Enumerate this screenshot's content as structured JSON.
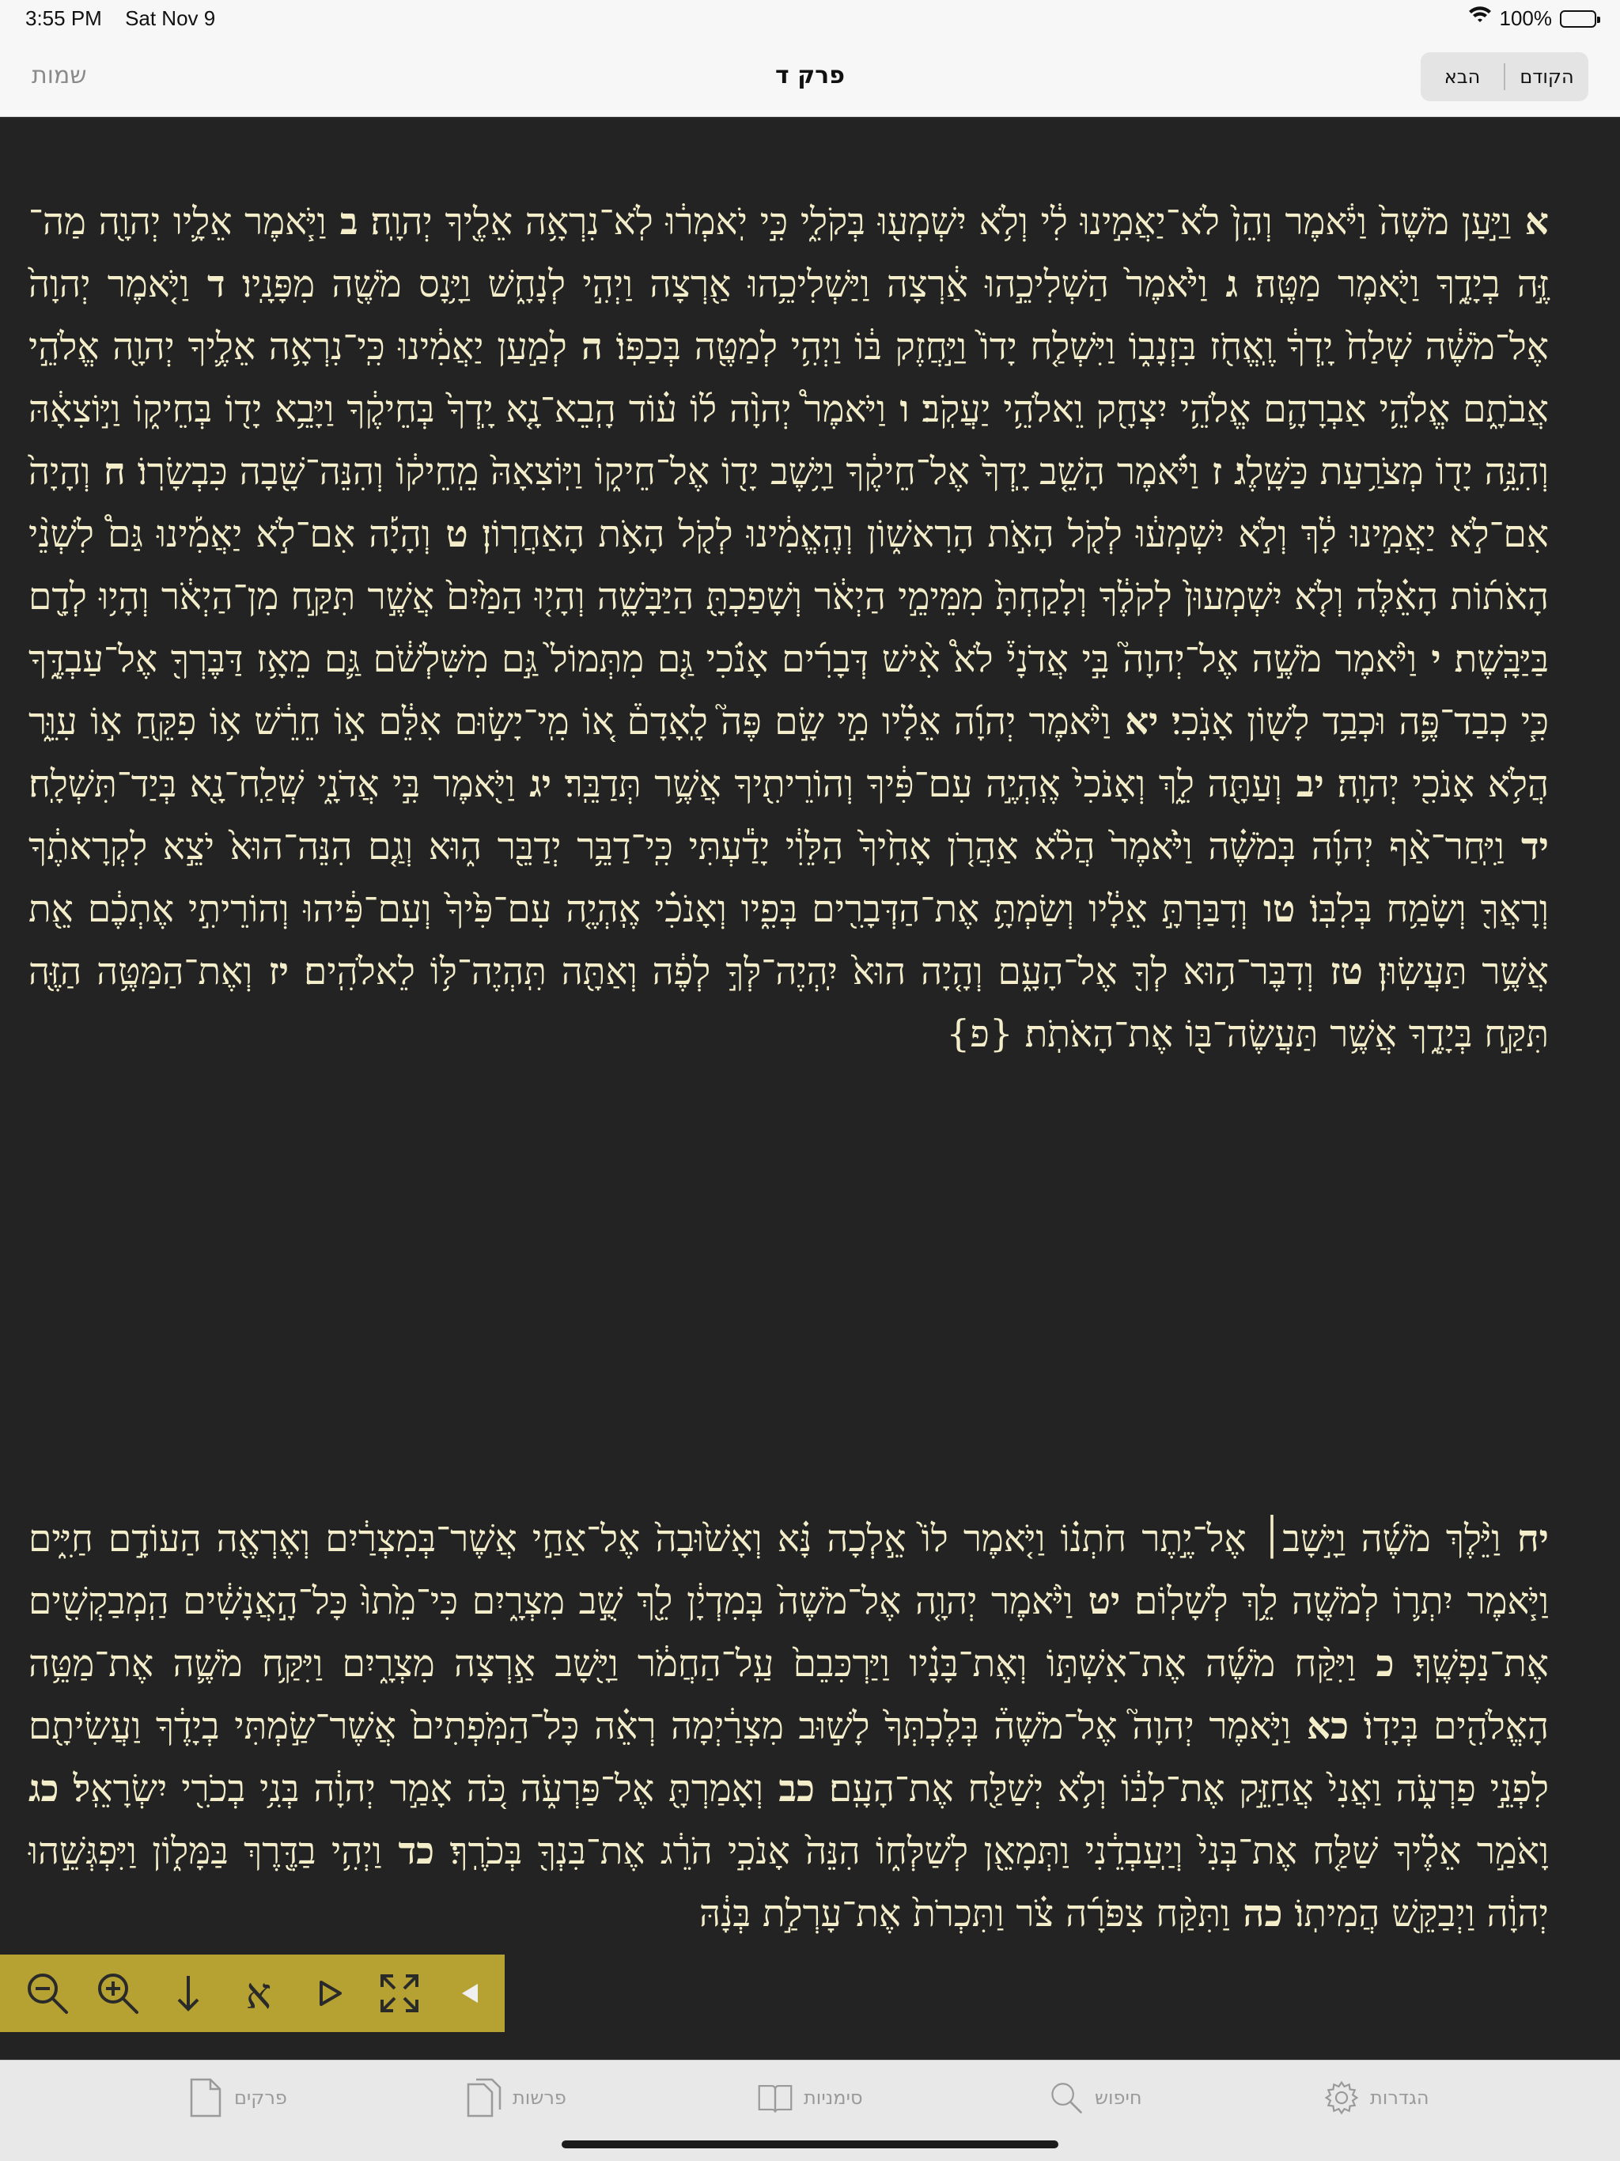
{
  "status": {
    "time": "3:55 PM",
    "date": "Sat Nov 9",
    "battery": "100%",
    "battery_level": 1.0
  },
  "nav": {
    "title": "פרק ד",
    "back_label": "שמות",
    "prev_label": "הקודם",
    "next_label": "הבא"
  },
  "text": {
    "para1": [
      {
        "n": "א",
        "t": "וַיַּ֣עַן מֹשֶׁה֙ וַיֹּ֔אמֶר וְהֵן֙ לֹא־יַאֲמִ֣ינוּ לִ֔י וְלֹ֥א יִשְׁמְע֖וּ בְּקֹלִ֑י כִּ֣י יֹֽאמְר֔וּ לֹֽא־נִרְאָ֥ה אֵלֶ֖יךָ יְהוָֽה׃"
      },
      {
        "n": "ב",
        "t": "וַיֹּ֧אמֶר אֵלָ֛יו יְהוָ֖ה מַה־ זֶּ֣ה בְיָדֶ֑ךָ וַיֹּ֖אמֶר מַטֶּֽה׃"
      },
      {
        "n": "ג",
        "t": "וַיֹּ֙אמֶר֙ הַשְׁלִיכֵ֣הוּ אַ֔רְצָה וַיַּשְׁלִיכֵ֥הוּ אַ֖רְצָה וַיְהִ֣י לְנָחָ֑שׁ וַיָּ֥נָס מֹשֶׁ֖ה מִפָּנָֽיו׃"
      },
      {
        "n": "ד",
        "t": "וַיֹּ֤אמֶר יְהוָה֙ אֶל־מֹשֶׁ֔ה שְׁלַח֙ יָֽדְךָ֔ וֶֽאֱחֹ֖ז בִּזְנָב֑וֹ וַיִּשְׁלַ֤ח יָדוֹ֙ וַיַּ֣חֲזֶק בּ֔וֹ וַיְהִ֥י לְמַטֶּ֖ה בְּכַפּֽוֹ׃"
      },
      {
        "n": "ה",
        "t": "לְמַ֣עַן יַאֲמִ֔ינוּ כִּֽי־נִרְאָ֥ה אֵלֶ֛יךָ יְהוָ֖ה אֱלֹהֵ֣י אֲבֹתָ֑ם אֱלֹהֵ֥י אַבְרָהָ֛ם אֱלֹהֵ֥י יִצְחָ֖ק וֵאלֹהֵ֥י יַעֲקֹֽב׃"
      },
      {
        "n": "ו",
        "t": "וַיֹּאמֶר֩ יְהוָ֨ה ל֜וֹ ע֗וֹד הָֽבֵא־נָ֤א יָֽדְךָ֙ בְּחֵיקֶ֔ךָ וַיָּבֵ֥א יָד֖וֹ בְּחֵיק֑וֹ וַיּ֣וֹצִאָ֔הּ וְהִנֵּ֥ה יָד֖וֹ מְצֹרַ֥עַת כַּשָּֽׁלֶג׃"
      },
      {
        "n": "ז",
        "t": "וַיֹּ֗אמֶר הָשֵׁ֤ב יָֽדְךָ֙ אֶל־חֵיקֶ֔ךָ וַיָּ֥שֶׁב יָד֖וֹ אֶל־חֵיק֑וֹ וַיּֽוֹצִאָהּ֙ מֵֽחֵיק֔וֹ וְהִנֵּה־שָׁ֖בָה כִּבְשָׂרֽוֹ׃"
      },
      {
        "n": "ח",
        "t": "וְהָיָה֙ אִם־לֹ֣א יַאֲמִ֣ינוּ לָ֔ךְ וְלֹ֣א יִשְׁמְע֔וּ לְקֹ֖ל הָאֹ֣ת הָרִאשׁ֑וֹן וְהֶֽאֱמִ֔ינוּ לְקֹ֖ל הָאֹ֥ת הָאַחֲרֽוֹן׃"
      },
      {
        "n": "ט",
        "t": "וְהָיָ֡ה אִם־לֹ֣א יַאֲמִ֡ינוּ גַּם֩ לִשְׁנֵ֨י הָאֹת֜וֹת הָאֵ֗לֶּה וְלֹ֤א יִשְׁמְעוּן֙ לְקֹלֶ֔ךָ וְלָקַחְתָּ֙ מִמֵּימֵ֣י הַיְאֹ֔ר וְשָׁפַכְתָּ֖ הַיַּבָּשָׁ֑ה וְהָי֤וּ הַמַּ֙יִם֙ אֲשֶׁ֣ר תִּקַּ֣ח מִן־הַיְאֹ֔ר וְהָי֥וּ לְדָ֖ם בַּיַּבָּֽשֶׁת׃"
      },
      {
        "n": "י",
        "t": "וַיֹּ֨אמֶר מֹשֶׁ֣ה אֶל־יְהוָה֮ בִּ֣י אֲדֹנָי֒ לֹא֩ אִ֨ישׁ דְּבָרִ֜ים אָנֹ֗כִי גַּ֤ם מִתְּמוֹל֙ גַּ֣ם מִשִּׁלְשֹׁ֔ם גַּ֛ם מֵאָ֥ז דַּבֶּרְךָ֖ אֶל־עַבְדֶּ֑ךָ כִּ֧י כְבַד־פֶּ֛ה וּכְבַ֥ד לָשׁ֖וֹן אָנֹֽכִי׃"
      },
      {
        "n": "יא",
        "t": "וַיֹּ֨אמֶר יְהוָ֜ה אֵלָ֗יו מִ֣י שָׂ֣ם פֶּה֮ לָֽאָדָם֒ א֚וֹ מִֽי־יָשׂ֣וּם אִלֵּ֔ם א֣וֹ חֵרֵ֔שׁ א֥וֹ פִקֵּ֖חַ א֣וֹ עִוֵּ֑ר הֲלֹ֥א אָנֹכִ֖י יְהוָֽה׃"
      },
      {
        "n": "יב",
        "t": "וְעַתָּ֖ה לֵ֑ךְ וְאָנֹכִי֙ אֶֽהְיֶ֣ה עִם־פִּ֔יךָ וְהוֹרֵיתִ֖יךָ אֲשֶׁ֥ר תְּדַבֵּֽר׃"
      },
      {
        "n": "יג",
        "t": "וַיֹּ֖אמֶר בִּ֣י אֲדֹנָ֑י שְֽׁלַֽח־נָ֖א בְּיַד־תִּשְׁלָֽח׃"
      },
      {
        "n": "יד",
        "t": "וַיִּֽחַר־אַ֨ף יְהוָ֜ה בְּמֹשֶׁ֗ה וַיֹּ֙אמֶר֙ הֲלֹ֨א אַהֲרֹ֤ן אָחִ֙יךָ֙ הַלֵּוִ֔י יָדַ֕עְתִּי כִּֽי־דַבֵּ֥ר יְדַבֵּ֖ר ה֑וּא וְגַ֤ם הִנֵּה־הוּא֙ יֹצֵ֣א לִקְרָאתֶ֔ךָ וְרָאֲךָ֖ וְשָׂמַ֥ח בְּלִבּֽוֹ׃"
      },
      {
        "n": "טו",
        "t": "וְדִבַּרְתָּ֣ אֵלָ֔יו וְשַׂמְתָּ֥ אֶת־הַדְּבָרִ֖ים בְּפִ֑יו וְאָנֹכִ֗י אֶֽהְיֶ֤ה עִם־פִּ֙יךָ֙ וְעִם־פִּ֔יהוּ וְהוֹרֵיתִ֣י אֶתְכֶ֔ם אֵ֖ת אֲשֶׁ֥ר תַּעֲשֽׂוּן׃"
      },
      {
        "n": "טז",
        "t": "וְדִבֶּר־ה֥וּא לְךָ֖ אֶל־הָעָ֑ם וְהָ֤יָה הוּא֙ יִֽהְיֶה־לְּךָ֣ לְפֶ֔ה וְאַתָּ֖ה תִּֽהְיֶה־לּ֥וֹ לֵאלֹהִֽים׃"
      },
      {
        "n": "יז",
        "t": "וְאֶת־הַמַּטֶּ֥ה הַזֶּ֖ה תִּקַּ֣ח בְּיָדֶ֑ךָ אֲשֶׁ֥ר תַּעֲשֶׂה־בּ֖וֹ אֶת־הָאֹתֹֽת׃ {פ}"
      }
    ],
    "para2": [
      {
        "n": "יח",
        "t": "וַיֵּ֨לֶךְ מֹשֶׁ֜ה וַיָּ֣שָׁב׀ אֶל־יֶ֣תֶר חֹתְנ֗וֹ וַיֹּ֤אמֶר לוֹ֙ אֵ֣לְכָה נָּ֗א וְאָשׁ֙וּבָה֙ אֶל־אַחַ֣י אֲשֶׁר־בְּמִצְרַ֔יִם וְאֶרְאֶ֖ה הַעוֹדָ֣ם חַיִּ֑ים וַיֹּ֧אמֶר יִתְר֛וֹ לְמֹשֶׁ֖ה לֵ֥ךְ לְשָׁלֽוֹם׃"
      },
      {
        "n": "יט",
        "t": "וַיֹּ֨אמֶר יְהוָ֤ה אֶל־מֹשֶׁה֙ בְּמִדְיָ֔ן לֵ֖ךְ שֻׁ֣ב מִצְרָ֑יִם כִּי־מֵ֙תוּ֙ כָּל־הָ֣אֲנָשִׁ֔ים הַֽמְבַקְשִׁ֖ים אֶת־נַפְשֶֽׁךָ׃"
      },
      {
        "n": "כ",
        "t": "וַיִּקַּ֨ח מֹשֶׁ֜ה אֶת־אִשְׁתּ֣וֹ וְאֶת־בָּנָ֗יו וַיַּרְכִּבֵם֙ עַֽל־הַחֲמֹ֔ר וַיָּ֖שָׁב אַ֣רְצָה מִצְרָ֑יִם וַיִּקַּ֥ח מֹשֶׁ֛ה אֶת־מַטֵּ֥ה הָאֱלֹהִ֖ים בְּיָדֽוֹ׃"
      },
      {
        "n": "כא",
        "t": "וַיֹּ֣אמֶר יְהוָה֮ אֶל־מֹשֶׁה֒ בְּלֶכְתְּךָ֙ לָשׁ֣וּב מִצְרַ֔יְמָה רְאֵ֗ה כָּל־הַמֹּֽפְתִים֙ אֲשֶׁר־שַׂ֣מְתִּי בְיָדֶ֔ךָ וַעֲשִׂיתָ֖ם לִפְנֵ֣י פַרְעֹ֑ה וַאֲנִי֙ אֲחַזֵּ֣ק אֶת־לִבּ֔וֹ וְלֹ֥א יְשַׁלַּ֖ח אֶת־הָעָֽם׃"
      },
      {
        "n": "כב",
        "t": "וְאָמַרְתָּ֖ אֶל־פַּרְעֹ֑ה כֹּ֚ה אָמַ֣ר יְהוָ֔ה בְּנִ֥י בְכֹרִ֖י יִשְׂרָאֵֽל׃"
      },
      {
        "n": "כג",
        "t": "וָאֹמַ֣ר אֵלֶ֗יךָ שַׁלַּ֤ח אֶת־בְּנִי֙ וְיַֽעַבְדֵ֔נִי וַתְּמָאֵ֖ן לְשַׁלְּח֑וֹ הִנֵּה֙ אָנֹכִ֣י הֹרֵ֔ג אֶת־בִּנְךָ֖ בְּכֹרֶֽךָ׃"
      },
      {
        "n": "כד",
        "t": "וַיְהִ֥י בַדֶּ֖רֶךְ בַּמָּל֑וֹן וַיִּפְגְּשֵׁ֣הוּ יְהוָ֔ה וַיְבַקֵּ֖שׁ הֲמִיתֽוֹ׃"
      },
      {
        "n": "כה",
        "t": "וַתִּקַּ֨ח צִפֹּרָ֜ה צֹ֗ר וַתִּכְרֹת֙ אֶת־עָרְלַ֣ת בְּנָ֔הּ"
      }
    ]
  },
  "toolbar": [
    {
      "name": "zoom-out-icon"
    },
    {
      "name": "zoom-in-icon"
    },
    {
      "name": "arrow-down-icon"
    },
    {
      "name": "font-aleph-icon",
      "glyph": "א"
    },
    {
      "name": "play-icon"
    },
    {
      "name": "fullscreen-icon"
    },
    {
      "name": "collapse-arrow-icon"
    }
  ],
  "tabs": {
    "chapters": "פרקים",
    "portions": "פרשות",
    "bookmarks": "סימניות",
    "search": "חיפוש",
    "settings": "הגדרות"
  },
  "colors": {
    "background": "#232323",
    "text": "#f3edc9",
    "toolbar": "#b6a232"
  }
}
